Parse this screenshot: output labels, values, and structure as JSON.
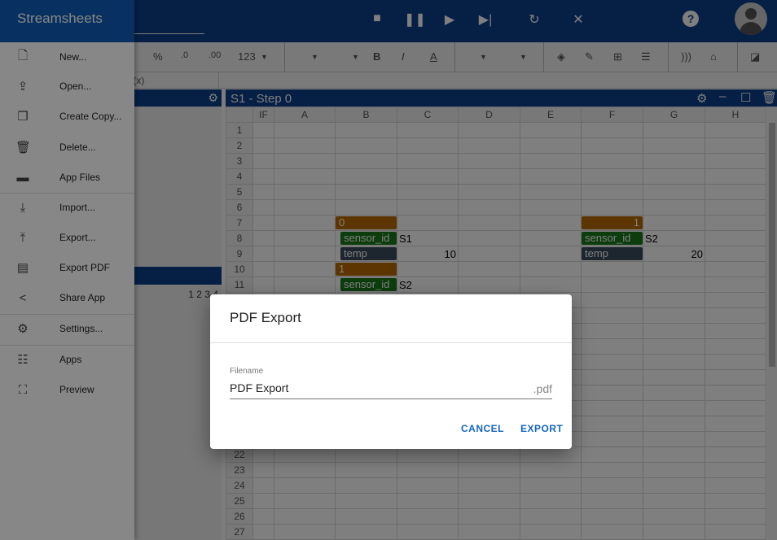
{
  "app": {
    "name": "Streamsheets"
  },
  "topbar": {
    "icons": [
      "stop-icon",
      "pause-icon",
      "play-icon",
      "step-icon",
      "reload-icon",
      "close-icon",
      "help-icon",
      "avatar-icon"
    ]
  },
  "toolbar": {
    "percent": "%",
    "dec_less": ".0",
    "dec_more": ".00",
    "number_format": "123",
    "bold": "B",
    "italic": "I",
    "font_color": "A"
  },
  "formula": {
    "label": "f(x)"
  },
  "left_panel": {
    "pages": "1 2 3 4"
  },
  "sheet": {
    "title": "S1 - Step 0",
    "columns": [
      "IF",
      "A",
      "B",
      "C",
      "D",
      "E",
      "F",
      "G",
      "H"
    ],
    "row_count": 27,
    "cells": [
      {
        "row": 7,
        "col": "B",
        "type": "obj",
        "text": "0"
      },
      {
        "row": 8,
        "col": "B",
        "type": "key",
        "text": "sensor_id"
      },
      {
        "row": 8,
        "col": "C",
        "type": "text",
        "text": "S1"
      },
      {
        "row": 9,
        "col": "B",
        "type": "numkey",
        "text": "temp"
      },
      {
        "row": 9,
        "col": "C",
        "type": "num",
        "text": "10"
      },
      {
        "row": 10,
        "col": "B",
        "type": "obj",
        "text": "1"
      },
      {
        "row": 11,
        "col": "B",
        "type": "key",
        "text": "sensor_id"
      },
      {
        "row": 11,
        "col": "C",
        "type": "text",
        "text": "S2"
      },
      {
        "row": 7,
        "col": "F",
        "type": "objr",
        "text": "1"
      },
      {
        "row": 8,
        "col": "F",
        "type": "key0",
        "text": "sensor_id"
      },
      {
        "row": 8,
        "col": "G",
        "type": "text",
        "text": "S2"
      },
      {
        "row": 9,
        "col": "F",
        "type": "numkey0",
        "text": "temp"
      },
      {
        "row": 9,
        "col": "G",
        "type": "num",
        "text": "20"
      }
    ]
  },
  "drawer": {
    "title": "Streamsheets",
    "items": [
      {
        "label": "New...",
        "icon": "new-file-icon"
      },
      {
        "label": "Open...",
        "icon": "open-icon"
      },
      {
        "label": "Create Copy...",
        "icon": "copy-icon"
      },
      {
        "label": "Delete...",
        "icon": "delete-icon"
      },
      {
        "label": "App Files",
        "icon": "folder-icon"
      },
      {
        "label": "Import...",
        "icon": "import-icon"
      },
      {
        "label": "Export...",
        "icon": "export-icon"
      },
      {
        "label": "Export PDF",
        "icon": "pdf-icon"
      },
      {
        "label": "Share App",
        "icon": "share-icon"
      },
      {
        "label": "Settings...",
        "icon": "settings-icon"
      },
      {
        "label": "Apps",
        "icon": "apps-list-icon"
      },
      {
        "label": "Preview",
        "icon": "preview-icon"
      }
    ]
  },
  "dialog": {
    "title": "PDF Export",
    "filename_label": "Filename",
    "filename_value": "PDF Export",
    "suffix": ".pdf",
    "cancel": "CANCEL",
    "export": "EXPORT"
  },
  "colors": {
    "primary": "#0a3f8a",
    "accent": "#1565c0",
    "object": "#b86a00",
    "key": "#1a7a1a"
  }
}
